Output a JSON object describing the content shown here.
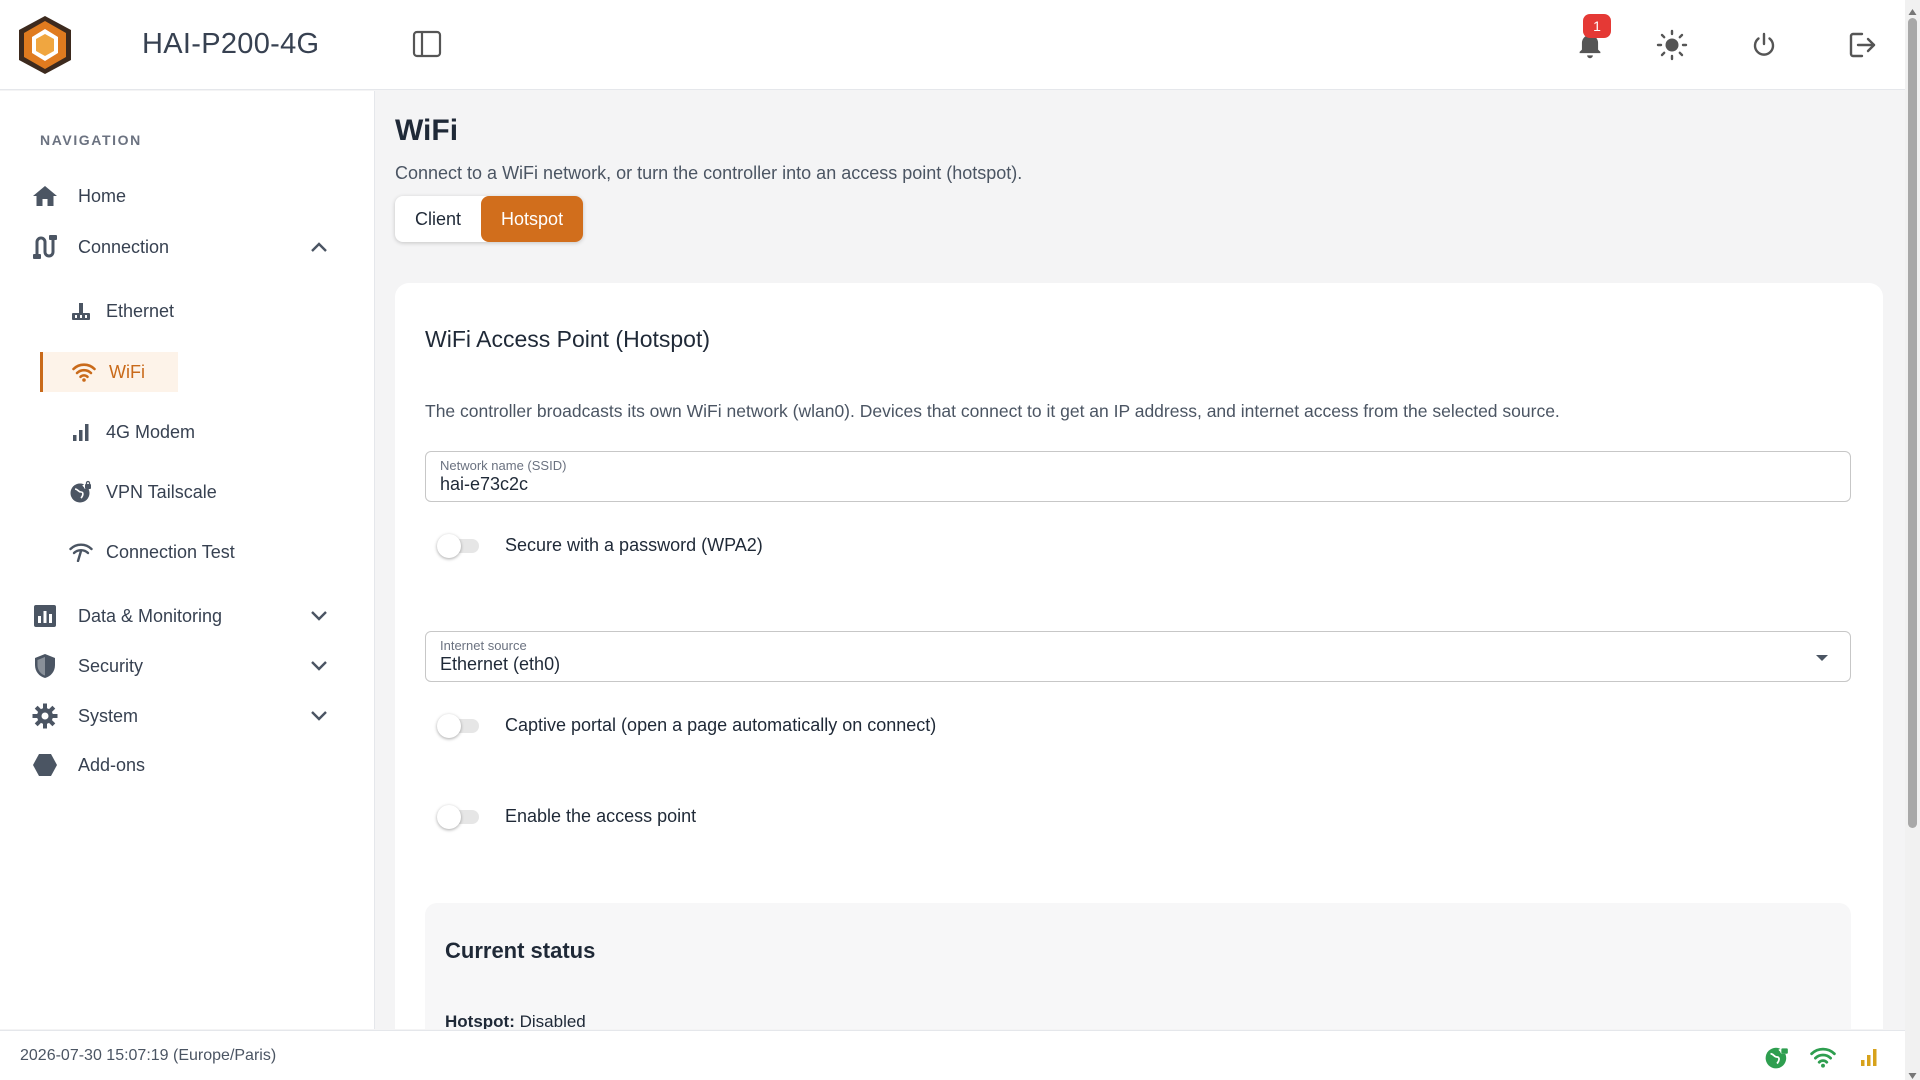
{
  "header": {
    "title": "HAI-P200-4G",
    "notification_count": "1"
  },
  "sidebar": {
    "heading": "NAVIGATION",
    "items": [
      {
        "label": "Home",
        "icon": "home-icon"
      },
      {
        "label": "Connection",
        "icon": "connection-icon",
        "expanded": true
      },
      {
        "label": "Data & Monitoring",
        "icon": "bar-chart-icon",
        "expanded": false
      },
      {
        "label": "Security",
        "icon": "shield-icon",
        "expanded": false
      },
      {
        "label": "System",
        "icon": "gear-icon",
        "expanded": false
      },
      {
        "label": "Add-ons",
        "icon": "hexagon-icon"
      }
    ],
    "connection_subitems": [
      {
        "label": "Ethernet",
        "icon": "ethernet-icon"
      },
      {
        "label": "WiFi",
        "icon": "wifi-icon",
        "active": true
      },
      {
        "label": "4G Modem",
        "icon": "signal-bars-icon"
      },
      {
        "label": "VPN Tailscale",
        "icon": "vpn-globe-icon"
      },
      {
        "label": "Connection Test",
        "icon": "wifi-test-icon"
      }
    ]
  },
  "main": {
    "title": "WiFi",
    "subtitle": "Connect to a WiFi network, or turn the controller into an access point (hotspot).",
    "tabs": [
      {
        "label": "Client",
        "active": false
      },
      {
        "label": "Hotspot",
        "active": true
      }
    ],
    "card": {
      "title": "WiFi Access Point (Hotspot)",
      "description": "The controller broadcasts its own WiFi network (wlan0). Devices that connect to it get an IP address, and internet access from the selected source.",
      "ssid": {
        "label": "Network name (SSID)",
        "value": "hai-e73c2c"
      },
      "password_toggle": {
        "label": "Secure with a password (WPA2)",
        "on": false
      },
      "internet_source": {
        "label": "Internet source",
        "value": "Ethernet (eth0)"
      },
      "captive_toggle": {
        "label": "Captive portal (open a page automatically on connect)",
        "on": false
      },
      "enable_toggle": {
        "label": "Enable the access point",
        "on": false
      },
      "status": {
        "title": "Current status",
        "hotspot_label": "Hotspot:",
        "hotspot_value": "Disabled"
      }
    }
  },
  "footer": {
    "datetime": "2026-07-30 15:07:19 (Europe/Paris)"
  },
  "colors": {
    "accent": "#d16e1c",
    "active_bg": "#fdf3e9",
    "badge": "#e53935",
    "status_green": "#2e9e4f",
    "status_amber": "#d7a21b"
  }
}
